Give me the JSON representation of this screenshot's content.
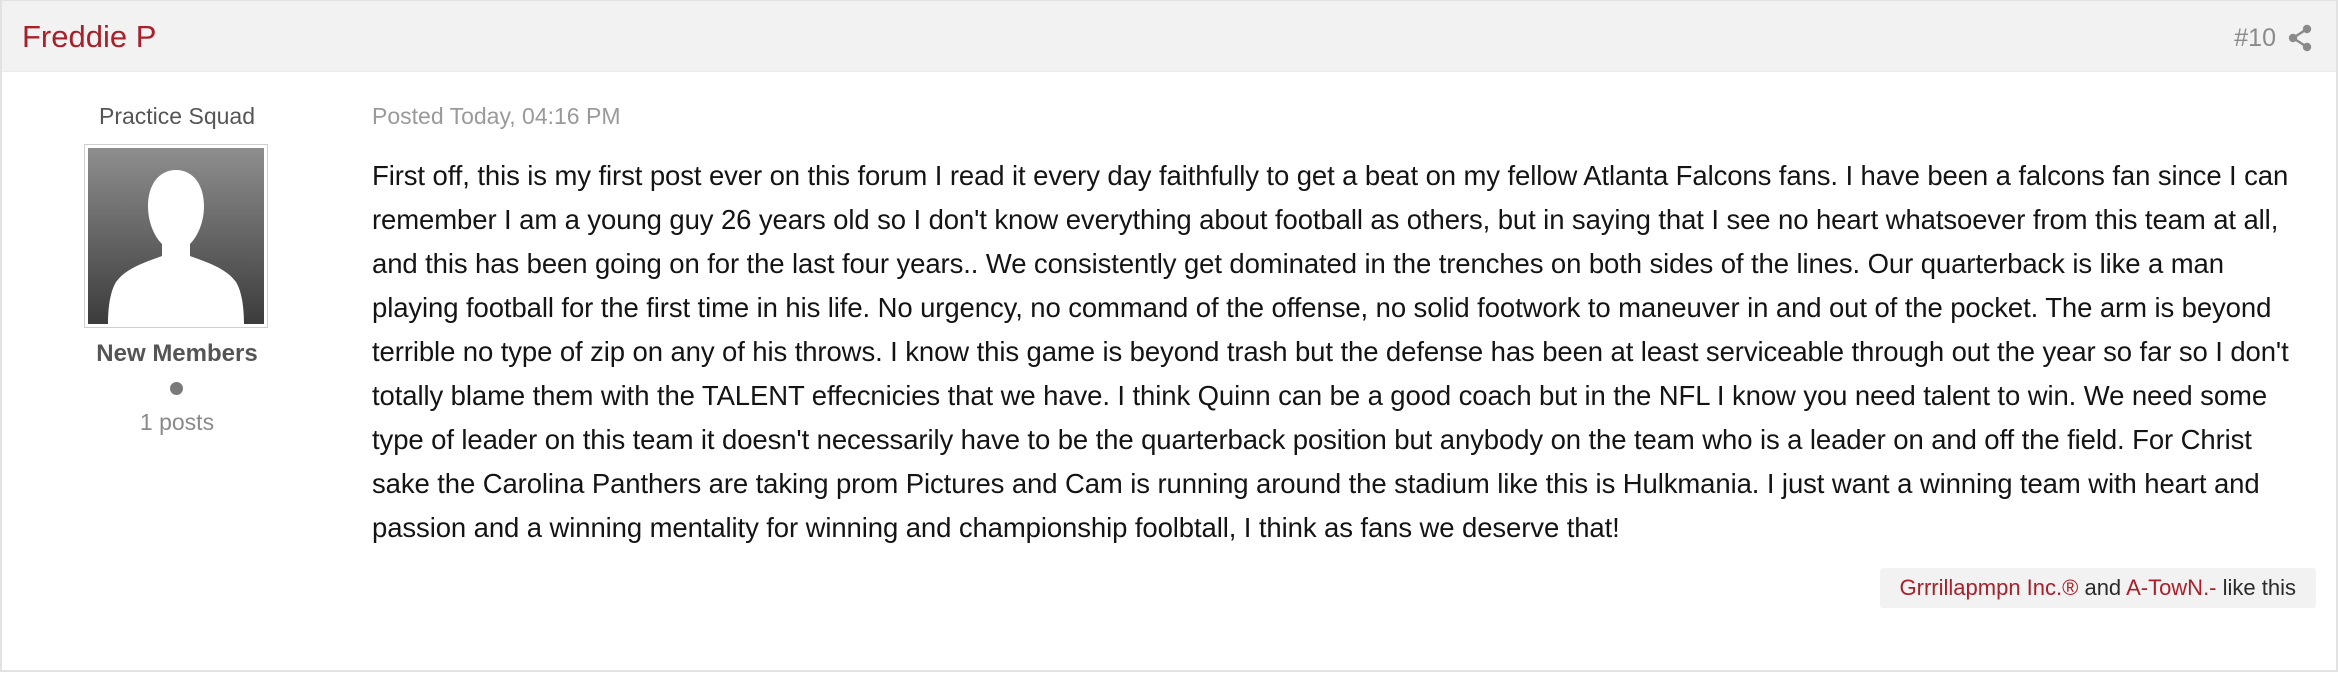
{
  "header": {
    "author_name": "Freddie P",
    "post_number": "#10",
    "share_icon": "share-icon"
  },
  "author": {
    "rank_title": "Practice Squad",
    "avatar_icon": "default-avatar-silhouette",
    "group_name": "New Members",
    "post_count": "1 posts"
  },
  "post": {
    "date": "Posted Today, 04:16 PM",
    "content": "First off, this is my first post ever on this forum I read it every day faithfully to get a beat on my fellow Atlanta Falcons fans. I have been a falcons fan since I can remember I am a young guy 26 years old so I don't know everything about football as others, but in saying that I see no heart whatsoever from this team at all, and this has been going on for the last four years.. We consistently get dominated in the trenches on both sides of the lines. Our quarterback is like a man playing football for the first time in his life. No urgency, no command of the offense, no solid footwork to maneuver in and out of the pocket. The arm is beyond terrible no type of zip on any of his throws. I know this game is beyond trash but the defense has been at least serviceable through out the year so far so I don't totally blame them with the TALENT effecnicies that we have. I think Quinn can be a good coach but in the NFL I know you need talent to win. We need some type of leader on this team it doesn't necessarily have to be the quarterback position but anybody on the team who is a leader on and off the field. For Christ sake the Carolina Panthers are taking prom Pictures and Cam is running around the stadium like this is Hulkmania. I just want a winning team with heart and passion and a winning mentality for winning and championship foolbtall, I think as fans we deserve that!"
  },
  "reputation": {
    "user_1": "Grrrillapmpn Inc.®",
    "conjunction": " and ",
    "user_2": "A-TowN.-",
    "suffix": " like this"
  },
  "colors": {
    "accent": "#a8202a",
    "header_bg": "#f2f2f2",
    "muted_text": "#8a8a8a"
  }
}
